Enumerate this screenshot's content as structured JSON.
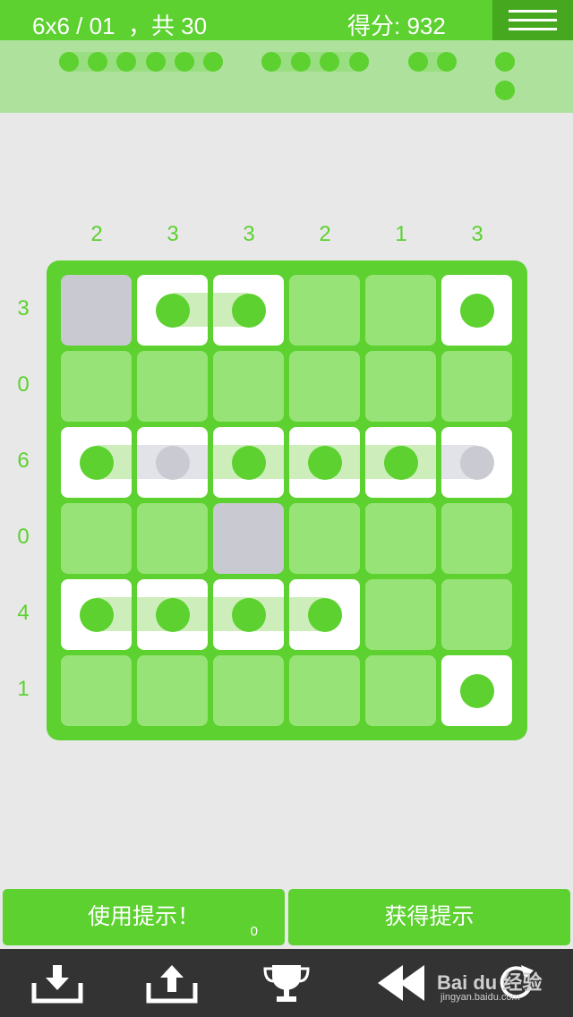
{
  "header": {
    "level_label": "6x6 / 01  ，共 30",
    "score_label": "得分: 932",
    "menu_icon": "hamburger-menu-icon"
  },
  "fleet": {
    "ship_lengths": [
      6,
      4,
      2,
      1,
      1
    ]
  },
  "board": {
    "size": 6,
    "column_clues": [
      "2",
      "3",
      "3",
      "2",
      "1",
      "3"
    ],
    "row_clues": [
      "3",
      "0",
      "6",
      "0",
      "4",
      "1"
    ],
    "cell_codes": [
      [
        "gray",
        "L",
        "R",
        "",
        "",
        "S"
      ],
      [
        "",
        "",
        "",
        "",
        "",
        ""
      ],
      [
        "L",
        "m",
        "M",
        "M",
        "M",
        "r"
      ],
      [
        "",
        "",
        "gray",
        "",
        "",
        ""
      ],
      [
        "L",
        "M",
        "M",
        "R",
        "",
        ""
      ],
      [
        "",
        "",
        "",
        "",
        "",
        "S"
      ]
    ],
    "legend": {
      "gray": "blocked",
      "L": "ship-left-end",
      "M": "ship-middle",
      "R": "ship-right-end",
      "S": "ship-single",
      "m": "ship-middle-unconfirmed",
      "r": "ship-right-end-unconfirmed",
      "": "empty-water"
    },
    "colors": {
      "accent": "#5cd12f",
      "water": "#98e377",
      "blocked": "#c8c9d1",
      "ship_cell": "#ffffff"
    }
  },
  "actions": {
    "use_hint_label": "使用提示！",
    "hint_count": "0",
    "get_hint_label": "获得提示"
  },
  "toolbar": {
    "icons": [
      "download-icon",
      "upload-icon",
      "trophy-icon",
      "rewind-icon",
      "refresh-icon"
    ]
  },
  "watermark": {
    "text": "Bai du 经验",
    "sub": "jingyan.baidu.com"
  }
}
